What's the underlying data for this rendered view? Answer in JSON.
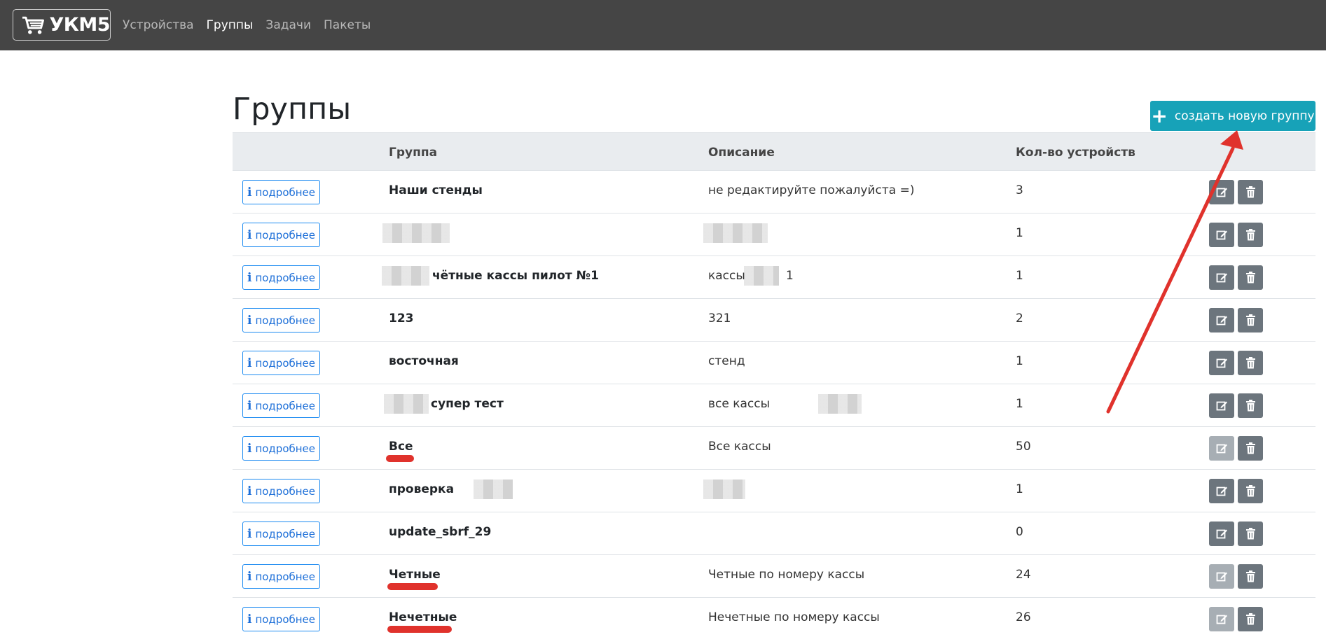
{
  "app": {
    "brand": "УКМ5"
  },
  "nav": {
    "items": [
      "Устройства",
      "Группы",
      "Задачи",
      "Пакеты"
    ],
    "active": "Группы"
  },
  "page": {
    "title": "Группы"
  },
  "toolbar": {
    "create_label": "создать новую группу"
  },
  "table": {
    "columns": [
      "Группа",
      "Описание",
      "Кол-во устройств"
    ],
    "details_label": "подробнее",
    "rows": [
      {
        "name": "Наши стенды",
        "description": "не редактируйте пожалуйста =)",
        "count": "3",
        "edit_disabled": false
      },
      {
        "name": "",
        "description": "",
        "count": "1",
        "edit_disabled": false
      },
      {
        "name": "чётные кассы пилот №1",
        "description": "кассы",
        "description_suffix": "1",
        "count": "1",
        "edit_disabled": false
      },
      {
        "name": "123",
        "description": "321",
        "count": "2",
        "edit_disabled": false
      },
      {
        "name": "восточная",
        "description": "стенд",
        "count": "1",
        "edit_disabled": false
      },
      {
        "name": "супер тест",
        "description": "все кассы",
        "count": "1",
        "edit_disabled": false
      },
      {
        "name": "Все",
        "description": "Все кассы",
        "count": "50",
        "edit_disabled": true
      },
      {
        "name": "проверка",
        "description": "",
        "count": "1",
        "edit_disabled": false
      },
      {
        "name": "update_sbrf_29",
        "description": "",
        "count": "0",
        "edit_disabled": false
      },
      {
        "name": "Четные",
        "description": "Четные по номеру кассы",
        "count": "24",
        "edit_disabled": true
      },
      {
        "name": "Нечетные",
        "description": "Нечетные по номеру кассы",
        "count": "26",
        "edit_disabled": true
      }
    ]
  },
  "icons": {
    "details": "info-icon",
    "edit": "edit-icon",
    "delete": "trash-icon",
    "create": "plus-icon",
    "brand": "cart-icon"
  },
  "colors": {
    "navbar": "#454545",
    "accent": "#17a2b8",
    "link": "#1d6fd8",
    "action": "#6c757d",
    "annotation": "#e0322c"
  }
}
